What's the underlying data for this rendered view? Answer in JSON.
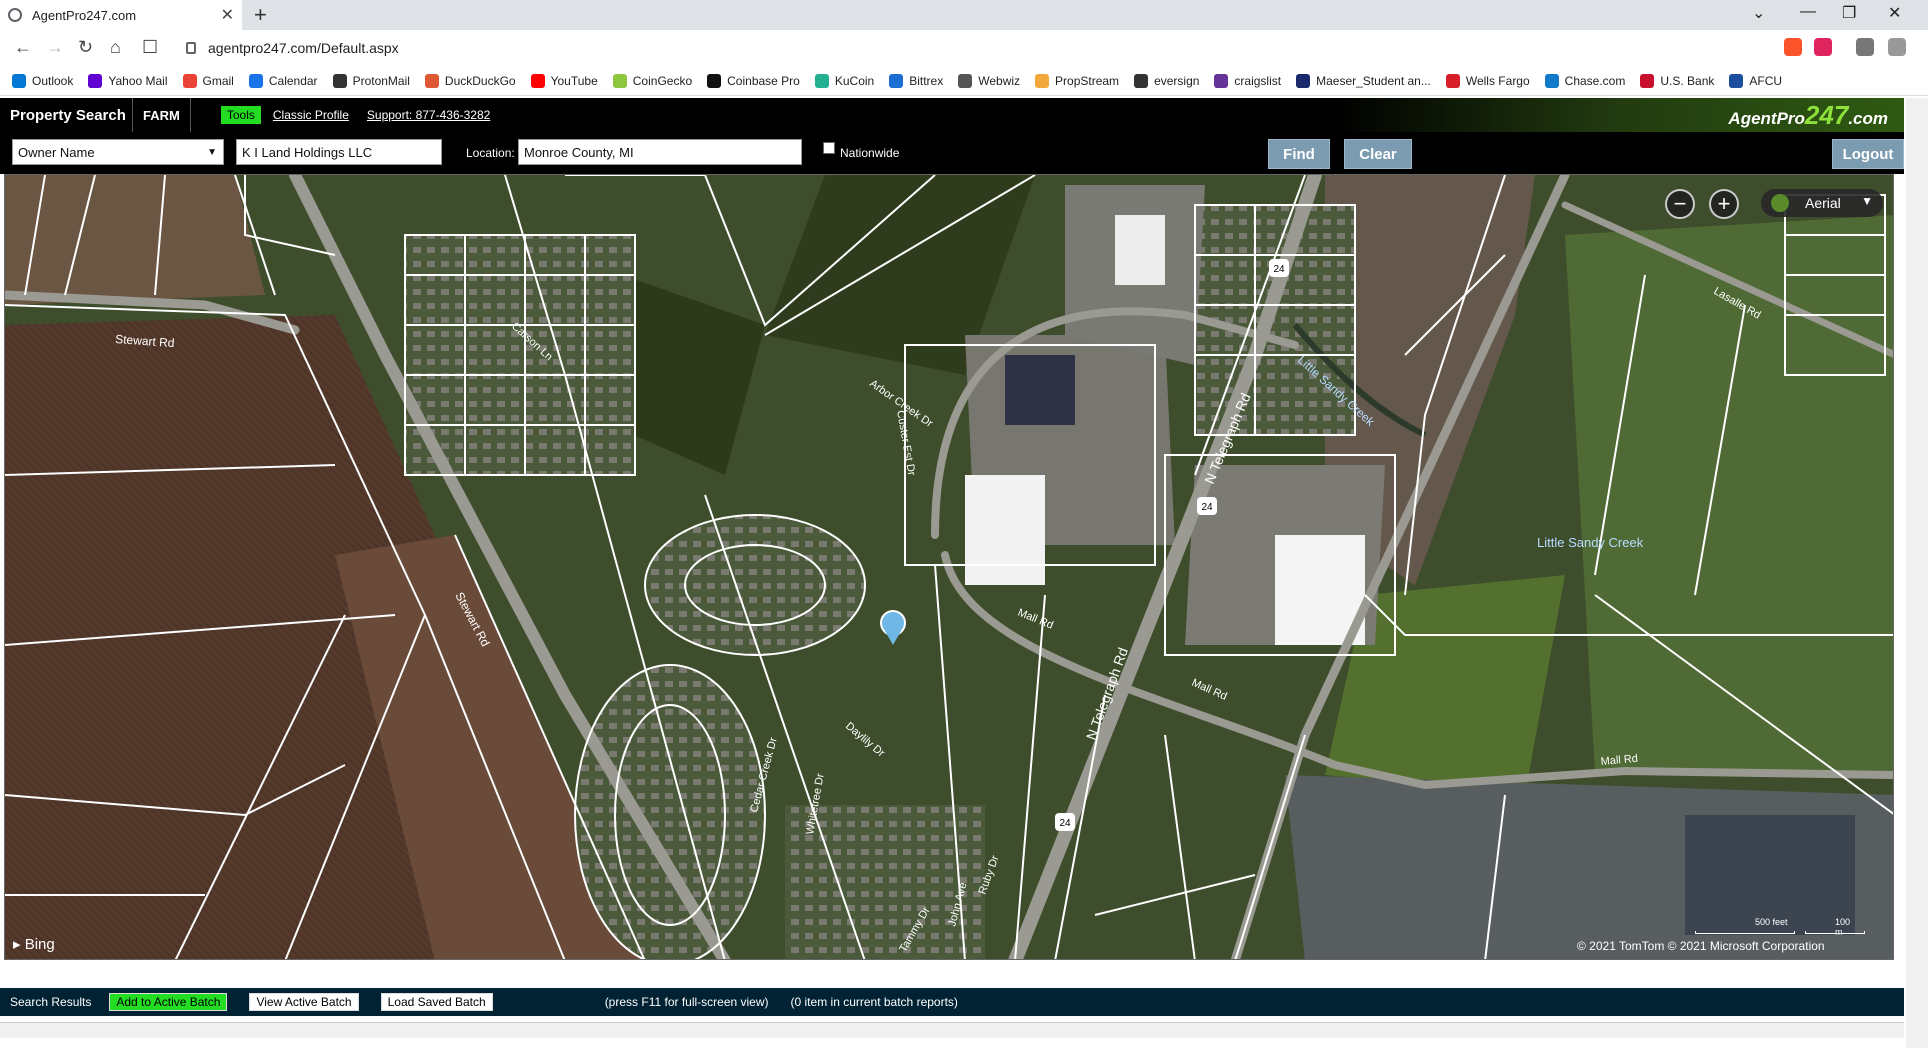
{
  "browser": {
    "tab_title": "AgentPro247.com",
    "url": "agentpro247.com/Default.aspx",
    "bookmarks": [
      "Outlook",
      "Yahoo Mail",
      "Gmail",
      "Calendar",
      "ProtonMail",
      "DuckDuckGo",
      "YouTube",
      "CoinGecko",
      "Coinbase Pro",
      "KuCoin",
      "Bittrex",
      "Webwiz",
      "PropStream",
      "eversign",
      "craigslist",
      "Maeser_Student an...",
      "Wells Fargo",
      "Chase.com",
      "U.S. Bank",
      "AFCU"
    ],
    "bookmark_colors": [
      "#0078d4",
      "#6001d2",
      "#ea4335",
      "#1a73e8",
      "#333333",
      "#de5833",
      "#ff0000",
      "#8dc63f",
      "#111111",
      "#23af91",
      "#1c6fd1",
      "#555555",
      "#f4a83c",
      "#333333",
      "#663399",
      "#1a2a6c",
      "#d71e28",
      "#117aca",
      "#c8102e",
      "#1b4f9c"
    ]
  },
  "header": {
    "title": "Property Search",
    "farm": "FARM",
    "tools": "Tools",
    "classic": "Classic Profile",
    "support": "Support: 877-436-3282",
    "logo_a": "AgentPro",
    "logo_b": "247",
    "logo_c": ".com"
  },
  "search": {
    "field": "Owner Name",
    "query": "K I Land Holdings LLC",
    "location_label": "Location:",
    "location": "Monroe County, MI",
    "nationwide": "Nationwide",
    "find": "Find",
    "clear": "Clear",
    "logout": "Logout"
  },
  "map": {
    "basemap": "Aerial",
    "bing": "Bing",
    "copyright": "© 2021 TomTom © 2021 Microsoft Corporation",
    "scale_ft": "500 feet",
    "scale_m": "100 m",
    "labels": {
      "stewart_rd": "Stewart Rd",
      "stewart_rd_2": "Stewart Rd",
      "carson_ln": "Carson Ln",
      "arbor_creek": "Arbor Creek Dr",
      "custer_est": "Custer Est Dr",
      "telegraph": "N Telegraph Rd",
      "telegraph_2": "N Telegraph Rd",
      "little_sandy": "Little Sandy Creek",
      "little_sandy_2": "Little Sandy Creek",
      "mall_rd": "Mall Rd",
      "mall_rd_2": "Mall Rd",
      "mall_rd_3": "Mall Rd",
      "lasalle": "Lasalle Rd",
      "daylily": "Daylily Dr",
      "cedar_creek": "Cedar Creek Dr",
      "whitetree": "Whitetree Dr",
      "john_ave": "John Ave",
      "ruby_dr": "Ruby Dr",
      "tammy_dr": "Tammy Dr",
      "route": "24"
    }
  },
  "footer": {
    "results": "Search Results",
    "add": "Add to Active Batch",
    "view": "View Active Batch",
    "load": "Load Saved Batch",
    "hint": "(press F11 for full-screen view)",
    "count": "(0 item in current batch reports)"
  }
}
